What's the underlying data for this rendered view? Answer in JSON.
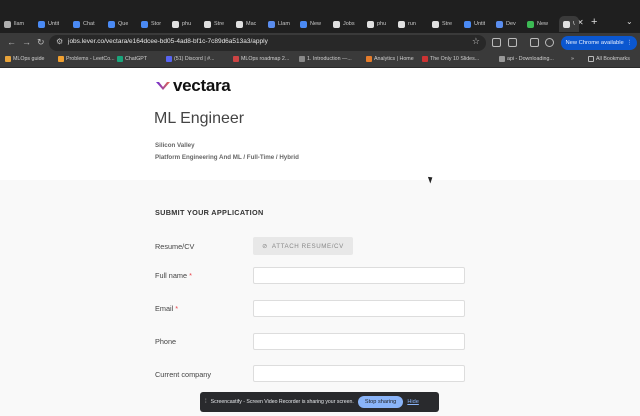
{
  "browser": {
    "tabs": [
      {
        "label": "llam",
        "color": "#b0b0b0"
      },
      {
        "label": "Untit",
        "color": "#4a8af4"
      },
      {
        "label": "Chat",
        "color": "#4a8af4"
      },
      {
        "label": "Que",
        "color": "#4a8af4"
      },
      {
        "label": "Stor",
        "color": "#4a8af4"
      },
      {
        "label": "phu",
        "color": "#e0e0e0"
      },
      {
        "label": "Stre",
        "color": "#e0e0e0"
      },
      {
        "label": "Mac",
        "color": "#e0e0e0"
      },
      {
        "label": "Llam",
        "color": "#5a8dee"
      },
      {
        "label": "New",
        "color": "#4a8af4"
      },
      {
        "label": "Jobs",
        "color": "#e0e0e0"
      },
      {
        "label": "phu",
        "color": "#e0e0e0"
      },
      {
        "label": "run",
        "color": "#e0e0e0"
      },
      {
        "label": "Stre",
        "color": "#e0e0e0"
      },
      {
        "label": "Untit",
        "color": "#4a8af4"
      },
      {
        "label": "Dev",
        "color": "#5a8dee"
      },
      {
        "label": "New",
        "color": "#3cba54"
      },
      {
        "label": "\\",
        "color": "#e0e0e0",
        "active": true
      }
    ],
    "url": "jobs.lever.co/vectara/e164dcee-bd05-4ad8-bf1c-7c89d6a513a3/apply",
    "update_label": "New Chrome available",
    "bookmarks": [
      "MLOps guide",
      "Problems - LeetCo...",
      "ChatGPT",
      "(51) Discord | #...",
      "MLOps roadmap 2...",
      "1. Introduction —...",
      "Analytics | Home",
      "The Only 10 Slides...",
      "api - Downloading..."
    ],
    "all_bookmarks_label": "All Bookmarks"
  },
  "job": {
    "company": "vectara",
    "title": "ML Engineer",
    "location": "Silicon Valley",
    "meta": "Platform Engineering And ML /   Full-Time   / Hybrid"
  },
  "form": {
    "section_title": "SUBMIT YOUR APPLICATION",
    "resume_label": "Resume/CV",
    "attach_label": "ATTACH RESUME/CV",
    "fields": [
      {
        "label": "Full name",
        "required": true
      },
      {
        "label": "Email",
        "required": true
      },
      {
        "label": "Phone",
        "required": false
      },
      {
        "label": "Current company",
        "required": false
      }
    ],
    "required_mark": "*"
  },
  "share_bar": {
    "message": "Screencastify - Screen Video Recorder is sharing your screen.",
    "stop_label": "Stop sharing",
    "hide_label": "Hide"
  },
  "colors": {
    "brand_gradient": [
      "#6a2bd9",
      "#e86a4a"
    ],
    "required": "#e8434a",
    "chrome_blue": "#0b57d0"
  }
}
